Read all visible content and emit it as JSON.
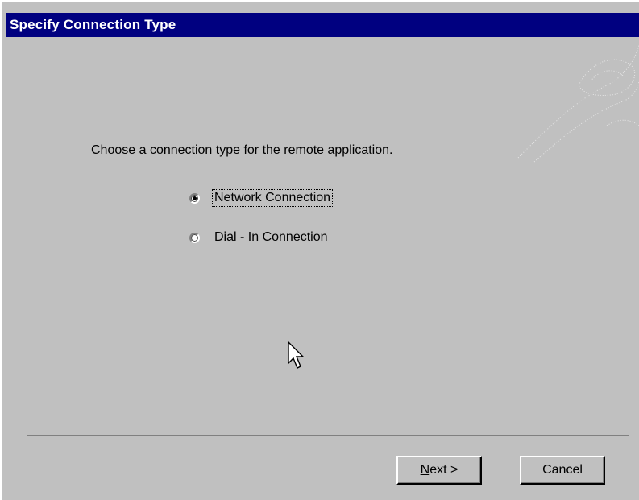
{
  "dialog": {
    "title": "Specify  Connection Type",
    "prompt": "Choose a connection type for the remote application."
  },
  "options": [
    {
      "label": "Network Connection",
      "selected": true
    },
    {
      "label": "Dial - In Connection",
      "selected": false
    }
  ],
  "buttons": {
    "next_mnemonic": "N",
    "next_rest": "ext >",
    "cancel_label": "Cancel"
  },
  "colors": {
    "titlebar": "#000080",
    "dialog_bg": "#c0c0c0"
  }
}
